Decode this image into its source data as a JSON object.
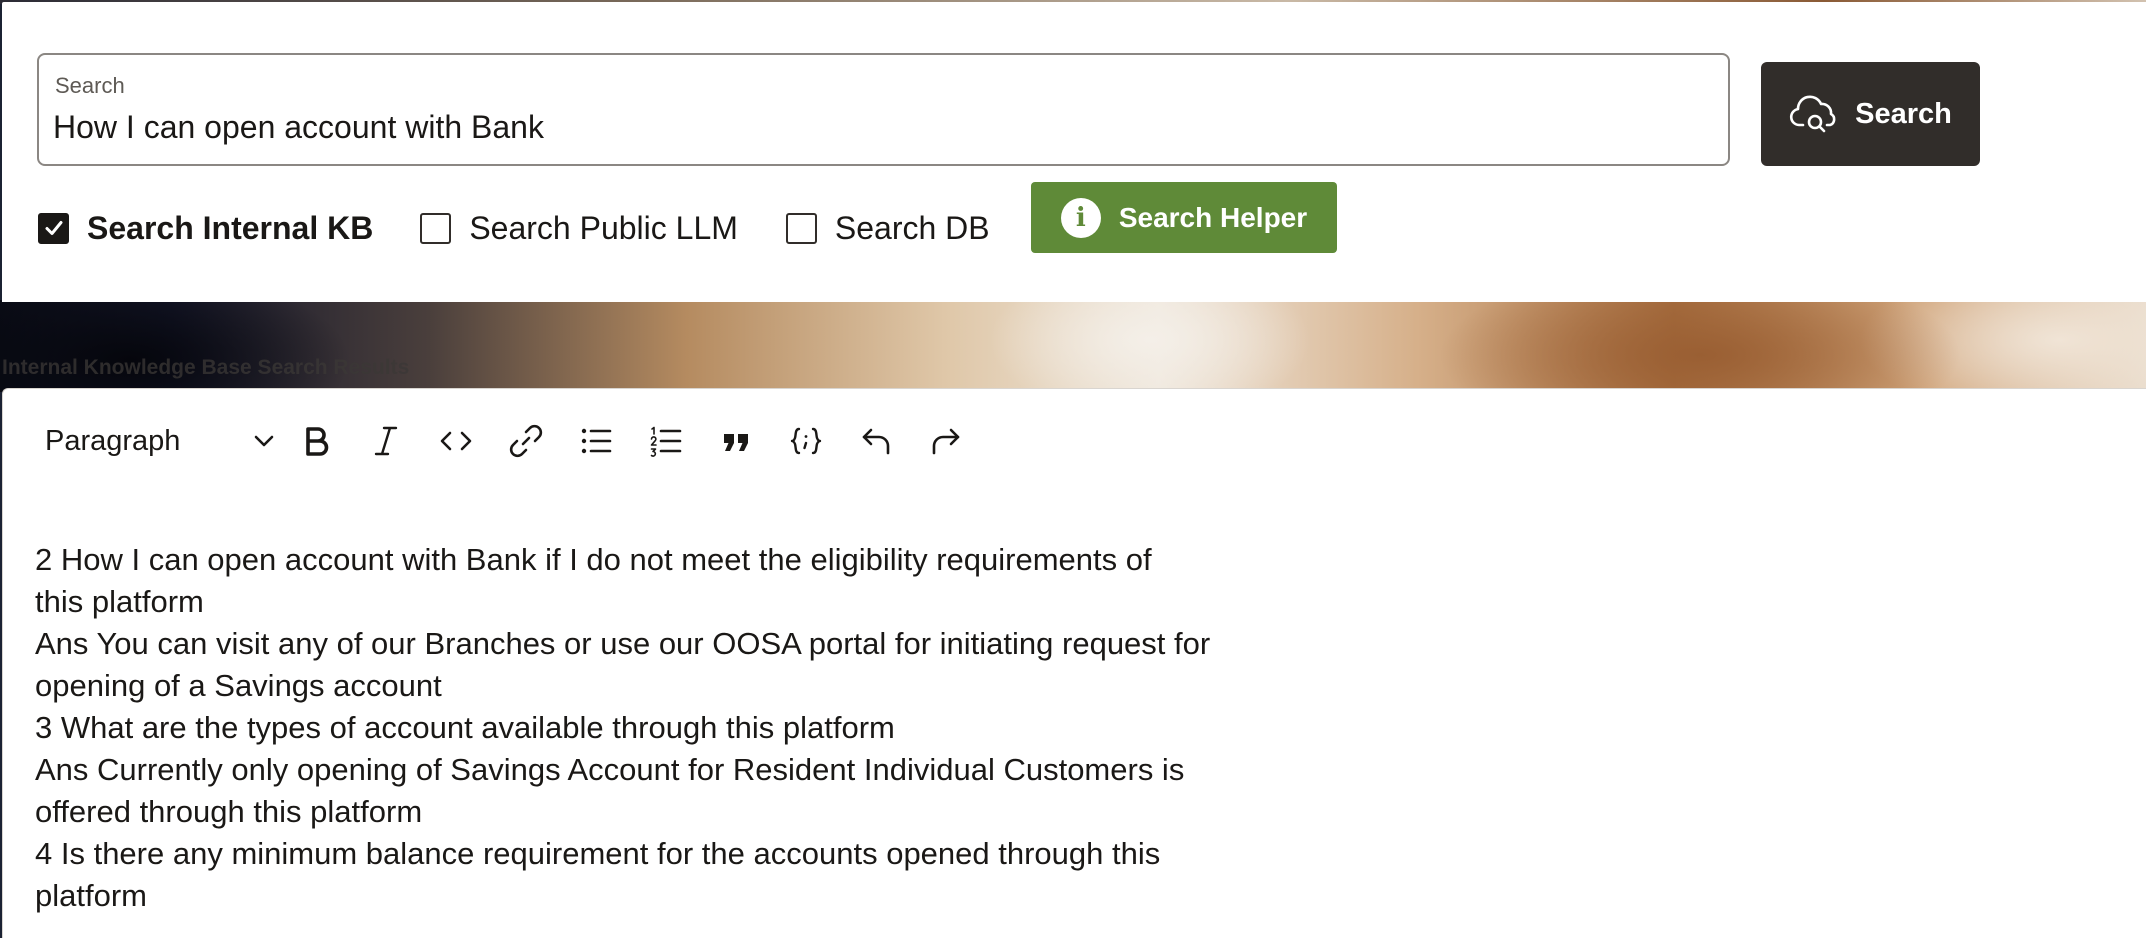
{
  "search": {
    "label": "Search",
    "query": "How I can open account with Bank",
    "button_label": "Search"
  },
  "sources": [
    {
      "label": "Search Internal KB",
      "checked": true
    },
    {
      "label": "Search Public LLM",
      "checked": false
    },
    {
      "label": "Search DB",
      "checked": false
    }
  ],
  "helper_button": {
    "label": "Search Helper",
    "icon_glyph": "i"
  },
  "results": {
    "section_label": "Internal Knowledge Base Search Results"
  },
  "editor": {
    "block_format": "Paragraph",
    "toolbar_icons": [
      "bold-icon",
      "italic-icon",
      "code-icon",
      "link-icon",
      "bulleted-list-icon",
      "numbered-list-icon",
      "blockquote-icon",
      "code-block-icon",
      "undo-icon",
      "redo-icon"
    ],
    "lines": [
      "2 How I can open account with Bank if I do not meet the eligibility requirements of",
      "this platform",
      "Ans You can visit any of our Branches or use our OOSA portal for initiating request for",
      "opening of a Savings account",
      "3 What are the types of account available through this platform",
      "Ans Currently only opening of Savings Account for Resident Individual Customers is",
      "offered through this platform",
      "4 Is there any minimum balance requirement for the accounts opened through this",
      "platform"
    ]
  },
  "colors": {
    "primary_button": "#312d2a",
    "helper_button": "#5f8a38",
    "text": "#1a1816"
  }
}
